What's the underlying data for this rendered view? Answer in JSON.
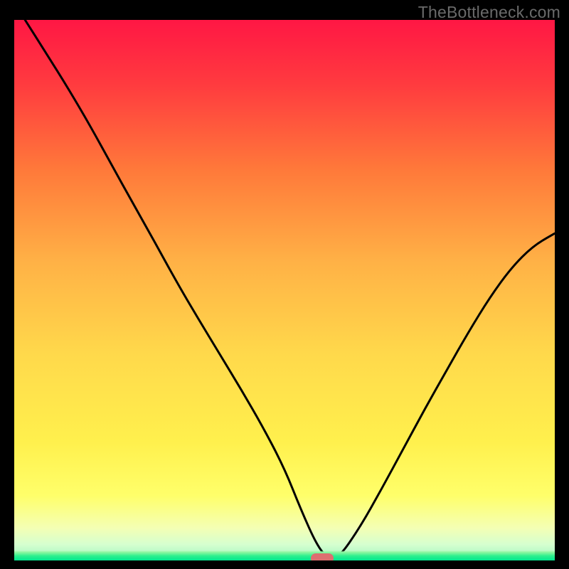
{
  "watermark": "TheBottleneck.com",
  "colors": {
    "background": "#000000",
    "watermark_text": "#6a6a6a",
    "curve_stroke": "#000000",
    "marker_fill": "#dd6f70",
    "gradient_top": "#ff1744",
    "gradient_mid_upper": "#ff8a3d",
    "gradient_mid": "#ffd246",
    "gradient_mid_lower": "#ffff59",
    "gradient_low": "#efffb0",
    "gradient_green": "#2cf08d"
  },
  "chart_data": {
    "type": "line",
    "title": "",
    "xlabel": "",
    "ylabel": "",
    "xlim": [
      0,
      100
    ],
    "ylim": [
      0,
      100
    ],
    "x": [
      2,
      6,
      10,
      14,
      18,
      22,
      26,
      30,
      34,
      38,
      42,
      46,
      50,
      53,
      56,
      58,
      60,
      64,
      68,
      72,
      76,
      80,
      84,
      88,
      92,
      96,
      100
    ],
    "values": [
      100.0,
      93.7,
      87.3,
      80.5,
      73.2,
      66.0,
      58.9,
      51.6,
      44.8,
      38.2,
      31.6,
      24.7,
      17.0,
      9.5,
      2.8,
      0.4,
      0.4,
      6.2,
      13.3,
      20.7,
      28.1,
      35.2,
      42.2,
      48.7,
      54.2,
      58.2,
      60.5
    ],
    "marker": {
      "x": 57,
      "y": 0
    },
    "annotations": []
  }
}
